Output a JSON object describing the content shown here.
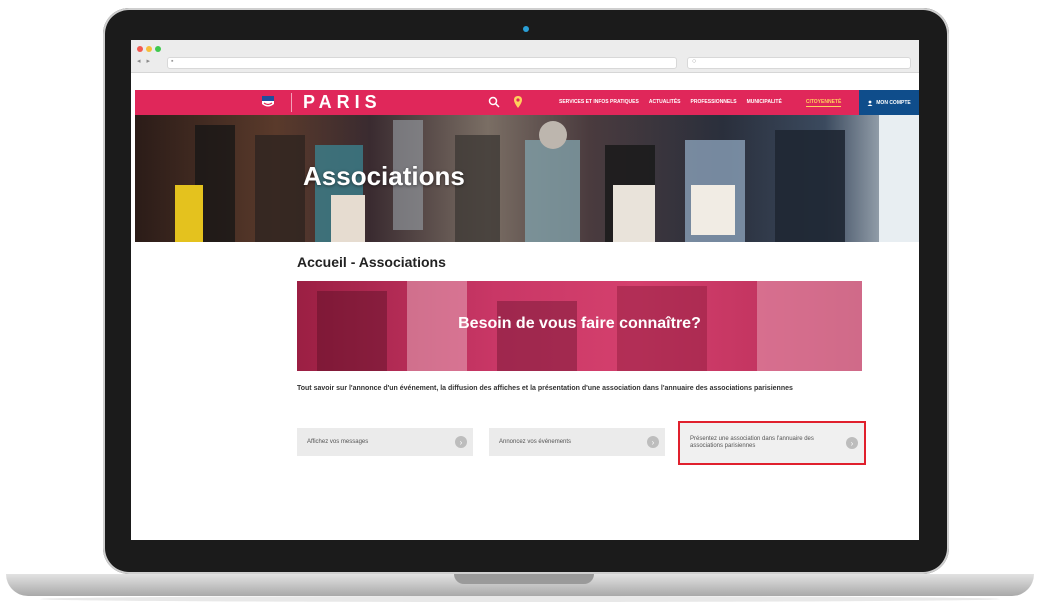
{
  "header": {
    "brand": "PARIS",
    "nav": [
      "Services et infos pratiques",
      "Actualités",
      "Professionnels",
      "Municipalité",
      "Citoyenneté"
    ],
    "account_label": "Mon compte"
  },
  "hero": {
    "title": "Associations"
  },
  "breadcrumb": "Accueil - Associations",
  "banner": {
    "title": "Besoin de vous faire connaître?"
  },
  "intro": "Tout savoir sur l'annonce d'un événement, la diffusion des affiches et la présentation d'une association dans l'annuaire des associations parisiennes",
  "cards": [
    {
      "label": "Affichez vos messages"
    },
    {
      "label": "Annoncez vos événements"
    },
    {
      "label": "Présentez une association dans l'annuaire des associations parisiennes"
    }
  ],
  "colors": {
    "brand": "#e0275a",
    "account": "#0f4d8b",
    "highlight": "#e0202d"
  }
}
